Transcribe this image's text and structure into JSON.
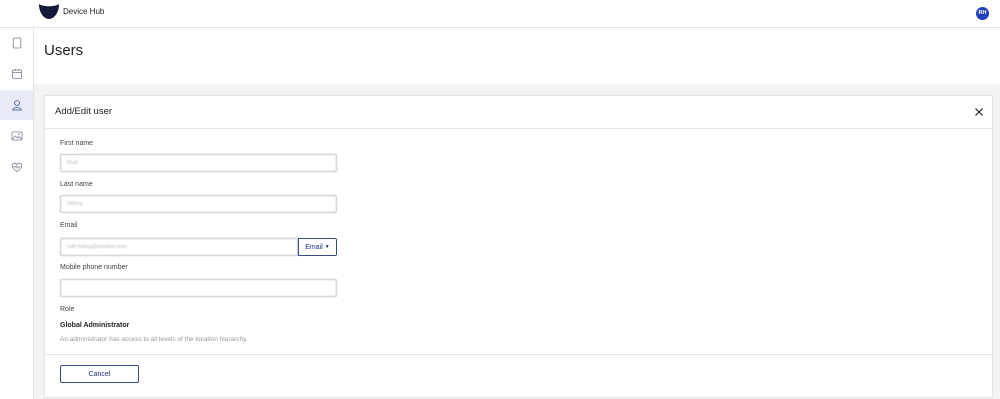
{
  "app": {
    "title": "Device Hub",
    "user_initials": "RH"
  },
  "colors": {
    "accent": "#1a2a80",
    "avatar_bg": "#1e3fbf",
    "active_nav_bg": "#e8ebf7"
  },
  "sidebar": {
    "items": [
      {
        "icon": "tablet-icon",
        "active": false
      },
      {
        "icon": "calendar-icon",
        "active": false
      },
      {
        "icon": "user-icon",
        "active": true
      },
      {
        "icon": "image-icon",
        "active": false
      },
      {
        "icon": "heart-pulse-icon",
        "active": false
      }
    ]
  },
  "page": {
    "title": "Users"
  },
  "dialog": {
    "title": "Add/Edit user",
    "close_icon": "close-icon",
    "fields": {
      "first_name": {
        "label": "First name",
        "value": "Ruth"
      },
      "last_name": {
        "label": "Last name",
        "value": "Hiking"
      },
      "email": {
        "label": "Email",
        "value": "ruth.hiking@epsilon.com",
        "type_button": "Email"
      },
      "mobile": {
        "label": "Mobile phone number",
        "value": ""
      }
    },
    "role": {
      "label": "Role",
      "value": "Global Administrator",
      "description": "An administrator has access to all levels of the location hierarchy."
    },
    "cancel_label": "Cancel"
  }
}
